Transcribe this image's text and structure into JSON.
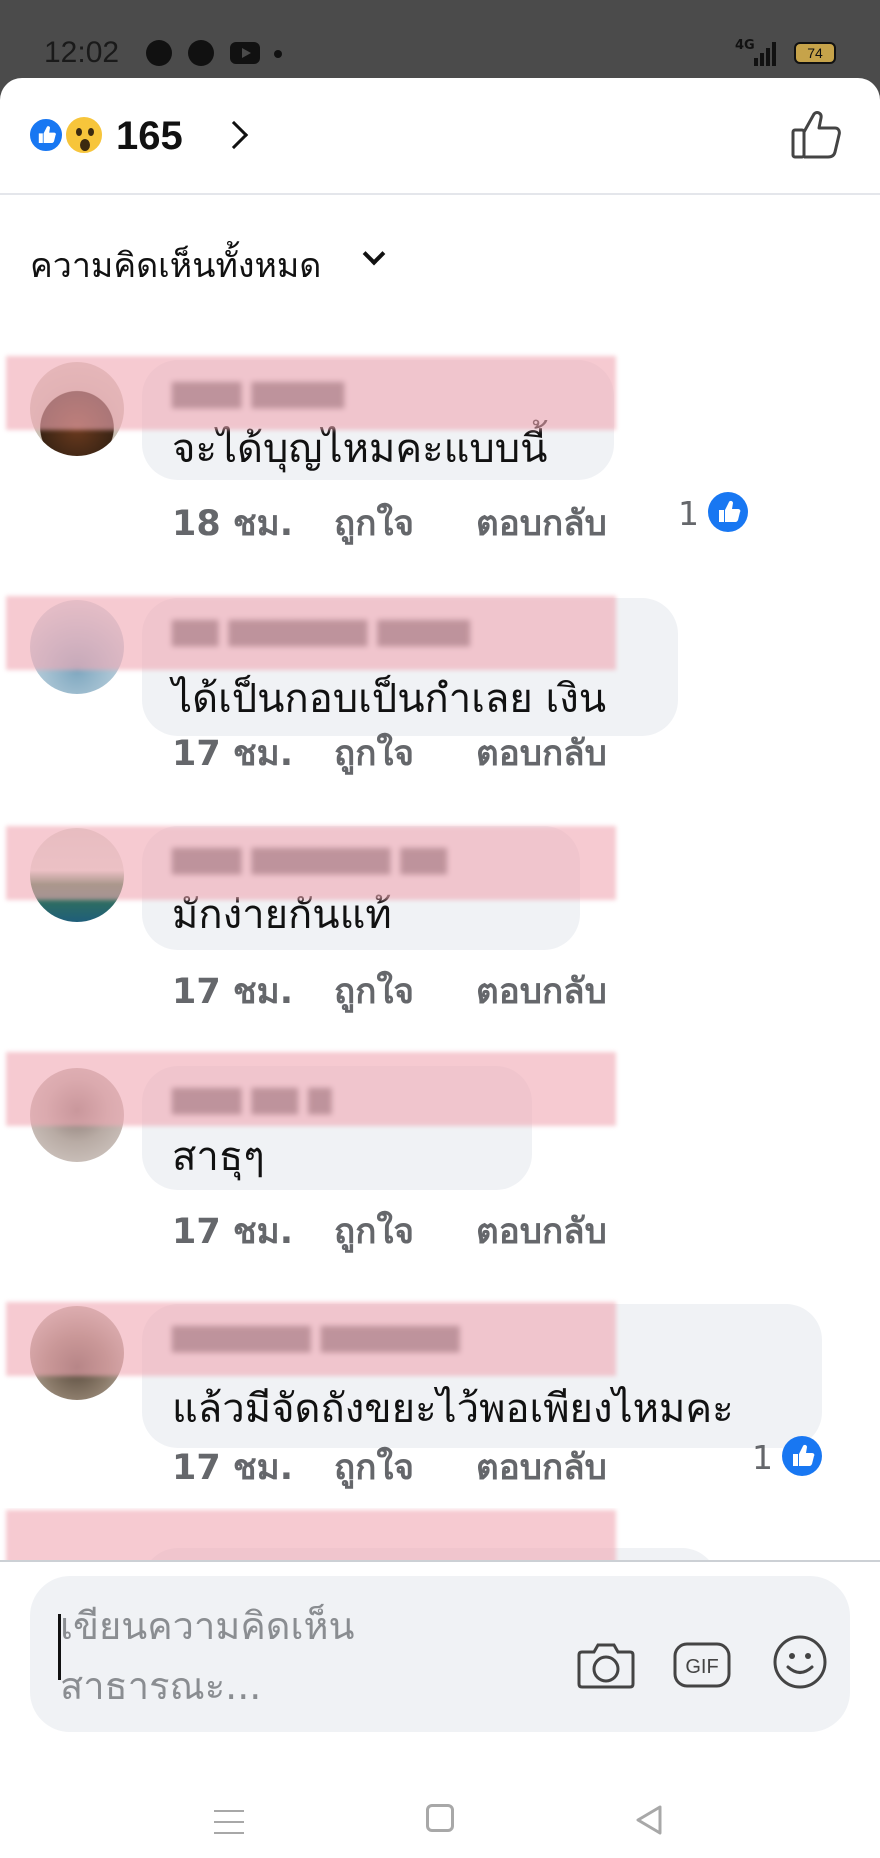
{
  "status_bar": {
    "time": "12:02",
    "network": "4G",
    "battery": "74"
  },
  "header": {
    "reaction_count": "165",
    "reactions": [
      "like-icon",
      "wow-icon"
    ]
  },
  "filter": {
    "label": "ความคิดเห็นทั้งหมด"
  },
  "comments": [
    {
      "text": "จะได้บุญไหมคะแบบนี้",
      "time": "18 ชม.",
      "like": "ถูกใจ",
      "reply": "ตอบกลับ",
      "reaction_count": "1"
    },
    {
      "text": "ได้เป็นกอบเป็นกำเลย เงิน",
      "time": "17 ชม.",
      "like": "ถูกใจ",
      "reply": "ตอบกลับ"
    },
    {
      "text": "มักง่ายกันแท้",
      "time": "17 ชม.",
      "like": "ถูกใจ",
      "reply": "ตอบกลับ"
    },
    {
      "text": "สาธุๆ",
      "time": "17 ชม.",
      "like": "ถูกใจ",
      "reply": "ตอบกลับ"
    },
    {
      "text": "แล้วมีจัดถังขยะไว้พอเพียงไหมคะ",
      "time": "17 ชม.",
      "like": "ถูกใจ",
      "reply": "ตอบกลับ",
      "reaction_count": "1"
    }
  ],
  "composer": {
    "placeholder_line1": "เขียนความคิดเห็น",
    "placeholder_line2": "สาธารณะ...",
    "gif_label": "GIF"
  },
  "colors": {
    "accent": "#1877f2",
    "bubble": "#f0f2f5",
    "meta_text": "#65676b",
    "redaction": "#f0aab4"
  }
}
